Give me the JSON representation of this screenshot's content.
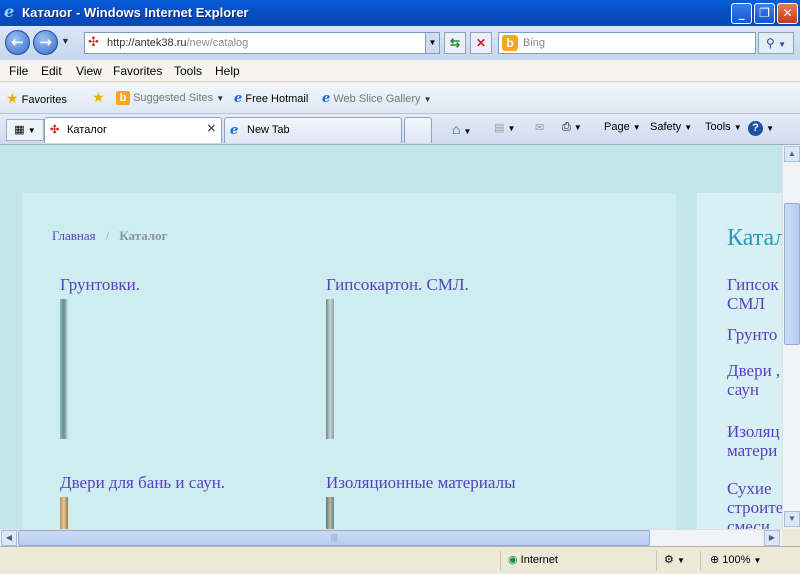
{
  "window": {
    "title": "Каталог - Windows Internet Explorer",
    "app_icon": "ie-icon"
  },
  "address_bar": {
    "url_host": "http://antek38.ru",
    "url_path": "/new/catalog",
    "search_placeholder": "Bing"
  },
  "menu": [
    "File",
    "Edit",
    "View",
    "Favorites",
    "Tools",
    "Help"
  ],
  "favorites_bar": {
    "favorites_label": "Favorites",
    "items": [
      "Suggested Sites",
      "Free Hotmail",
      "Web Slice Gallery"
    ]
  },
  "tabs": [
    {
      "label": "Каталог",
      "active": true
    },
    {
      "label": "New Tab",
      "active": false
    }
  ],
  "command_bar": {
    "page": "Page",
    "safety": "Safety",
    "tools": "Tools"
  },
  "page": {
    "breadcrumb": {
      "home": "Главная",
      "separator": "/",
      "current": "Каталог"
    },
    "categories": [
      "Грунтовки.",
      "Гипсокартон. СМЛ.",
      "Двери для бань и саун.",
      "Изоляционные материалы"
    ],
    "sidebar": {
      "heading": "Катал",
      "links": [
        [
          "Гипсок",
          "СМЛ"
        ],
        [
          "Грунто"
        ],
        [
          "Двери ,",
          "саун"
        ],
        [
          "Изоляц",
          "матери"
        ],
        [
          "Сухие",
          "строите",
          "смеси"
        ]
      ]
    }
  },
  "status_bar": {
    "zone": "Internet",
    "zoom": "100%"
  },
  "colors": {
    "page_background": "#c2e5ea",
    "link": "#5a3fbf",
    "sidebar_heading": "#2a9ab8",
    "titlebar": "#0550c8"
  }
}
